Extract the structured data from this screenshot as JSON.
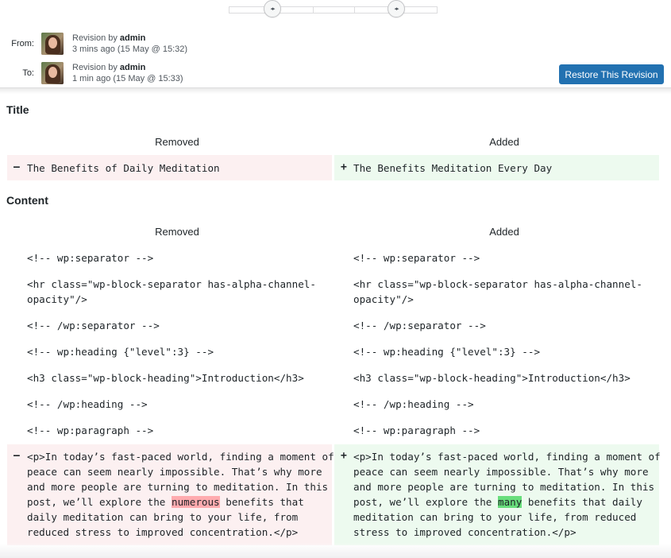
{
  "slider": {
    "handle_glyph": "◂▸"
  },
  "from": {
    "label": "From:",
    "prefix": "Revision by ",
    "author": "admin",
    "time": "3 mins ago (15 May @ 15:32)"
  },
  "to": {
    "label": "To:",
    "prefix": "Revision by ",
    "author": "admin",
    "time": "1 min ago (15 May @ 15:33)"
  },
  "restore_label": "Restore This Revision",
  "colors": {
    "accent": "#2271b1",
    "removed_bg": "#fcf0f1",
    "added_bg": "#edfaef",
    "removed_highlight": "#ffabaf",
    "added_highlight": "#68de7c"
  },
  "title_section": {
    "heading": "Title",
    "removed_head": "Removed",
    "added_head": "Added",
    "removed_sign": "–",
    "added_sign": "+",
    "removed_text": "The Benefits of Daily Meditation",
    "added_text": "The Benefits Meditation Every Day"
  },
  "content_section": {
    "heading": "Content",
    "removed_head": "Removed",
    "added_head": "Added",
    "context_lines": [
      "<!-- wp:separator -->",
      "<hr class=\"wp-block-separator has-alpha-channel-",
      "opacity\"/>",
      "<!-- /wp:separator -->",
      "<!-- wp:heading {\"level\":3} -->",
      "<h3 class=\"wp-block-heading\">Introduction</h3>",
      "<!-- /wp:heading -->",
      "<!-- wp:paragraph -->"
    ],
    "removed_sign": "–",
    "added_sign": "+",
    "removed_lines": [
      "<p>In today’s fast-paced world, finding a moment of",
      "peace can seem nearly impossible. That’s why more",
      "and more people are turning to meditation. In this",
      "post, we’ll explore the ",
      "numerous",
      " benefits that",
      "daily meditation can bring to your life, from",
      "reduced stress to improved concentration.</p>"
    ],
    "added_lines": [
      "<p>In today’s fast-paced world, finding a moment of",
      "peace can seem nearly impossible. That’s why more",
      "and more people are turning to meditation. In this",
      "post, we’ll explore the ",
      "many",
      " benefits that daily",
      "meditation can bring to your life, from reduced",
      "stress to improved concentration.</p>"
    ]
  }
}
